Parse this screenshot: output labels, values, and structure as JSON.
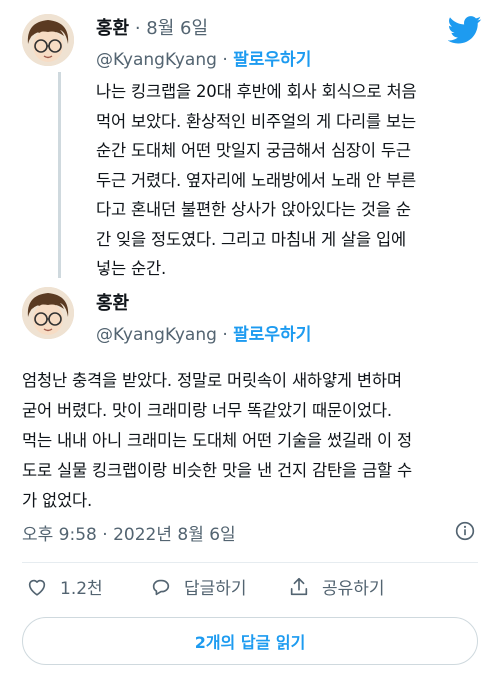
{
  "tweet1": {
    "name": "홍환",
    "separator": " · ",
    "date": "8월 6일",
    "handle": "@KyangKyang",
    "follow_label": "팔로우하기",
    "text": "나는 킹크랩을 20대 후반에 회사 회식으로 처음\n먹어 보았다. 환상적인 비주얼의 게 다리를 보는\n순간 도대체 어떤 맛일지 궁금해서 심장이 두근\n두근 거렸다. 옆자리에 노래방에서 노래 안 부른\n다고 혼내던 불편한 상사가 앉아있다는 것을 순\n간 잊을 정도였다. 그리고 마침내 게 살을 입에\n넣는 순간."
  },
  "tweet2": {
    "name": "홍환",
    "handle": "@KyangKyang",
    "separator": " · ",
    "follow_label": "팔로우하기",
    "text": "엄청난 충격을 받았다. 정말로 머릿속이 새하얗게 변하며\n굳어 버렸다. 맛이 크래미랑 너무 똑같았기 때문이었다.\n먹는 내내 아니 크래미는 도대체 어떤 기술을 썼길래 이 정\n도로 실물 킹크랩이랑 비슷한 맛을 낸 건지 감탄을 금할 수\n가 없었다.",
    "timestamp": "오후 9:58 · 2022년 8월 6일"
  },
  "actions": {
    "likes": "1.2천",
    "reply_label": "답글하기",
    "share_label": "공유하기"
  },
  "read_replies_label": "2개의 답글 읽기",
  "colors": {
    "accent": "#1d9bf0",
    "text": "#0f1419",
    "muted": "#536471"
  },
  "icons": [
    "avatar",
    "twitter-bird-icon",
    "info-icon",
    "heart-icon",
    "reply-icon",
    "share-icon"
  ]
}
